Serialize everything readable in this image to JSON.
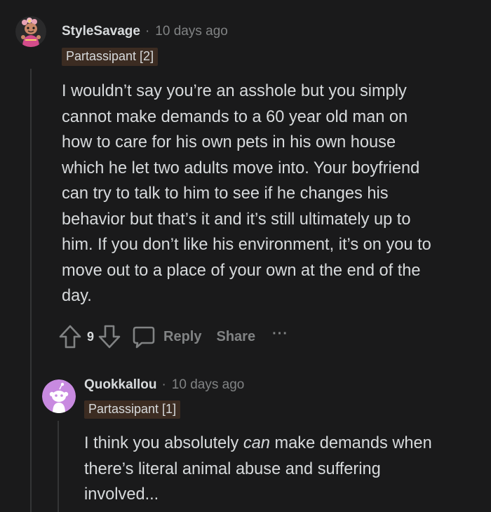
{
  "comments": [
    {
      "username": "StyleSavage",
      "separator": "·",
      "timestamp": "10 days ago",
      "flair": "Partassipant [2]",
      "body_lines": [
        "I wouldn’t say you’re an asshole but you simply",
        "cannot make demands to a 60 year old man on",
        "how to care for his own pets in his own house",
        "which he let two adults move into. Your boyfriend",
        "can try to talk to him to see if he changes his",
        "behavior but that’s it and it’s still ultimately up to",
        "him. If you don’t like his environment, it’s on you to",
        "move out to a place of your own at the end of the",
        "day."
      ],
      "vote_count": "9",
      "actions": {
        "reply": "Reply",
        "share": "Share",
        "more": "···"
      },
      "avatar_icon": "snoo-avatar-pink-icon"
    },
    {
      "username": "Quokkallou",
      "separator": "·",
      "timestamp": "10 days ago",
      "flair": "Partassipant [1]",
      "body_line1_pre": "I think you absolutely ",
      "body_line1_em": "can",
      "body_line1_post": " make demands when",
      "body_lines_rest": [
        "there’s literal animal abuse and suffering",
        "involved..."
      ],
      "avatar_icon": "default-snoo-avatar-purple-icon"
    }
  ],
  "colors": {
    "background": "#1a1a1b",
    "text": "#d7dadc",
    "muted": "#818384",
    "flair_bg": "#3c2c22",
    "thread_line": "#343536",
    "avatar2_bg": "#c88ae0"
  }
}
